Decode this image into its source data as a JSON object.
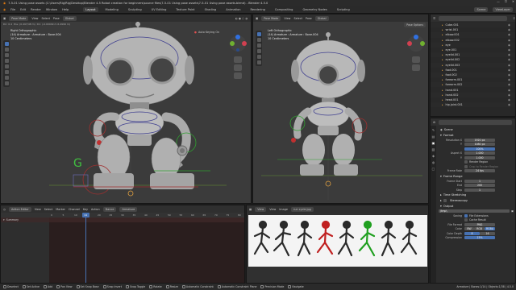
{
  "window": {
    "title": "7-5-01 Using pose assets (C:\\Users\\Rig\\Rig\\Desktop\\Blender 4.5 Robot creation for beginners\\source files\\7-5-01 Using pose assets\\7-5-01 Using pose assets.blend) - Blender 4.5.0",
    "min": "—",
    "max": "☐",
    "close": "✕"
  },
  "menus": [
    "File",
    "Edit",
    "Render",
    "Window",
    "Help"
  ],
  "workspaces": [
    "Layout",
    "Modeling",
    "Sculpting",
    "UV Editing",
    "Texture Paint",
    "Shading",
    "Animation",
    "Rendering",
    "Compositing",
    "Geometry Nodes",
    "Scripting"
  ],
  "active_workspace": "Layout",
  "scene_name": "Scene",
  "view_layer": "ViewLayer",
  "viewport_left": {
    "mode": "Pose Mode",
    "menu": [
      "View",
      "Select",
      "Pose"
    ],
    "orientation": "Global",
    "auto_keying": "Auto Keying On",
    "info": [
      "Right Orthographic",
      "(14) Armature : Armature : Bone.004",
      "10 Centimeters"
    ],
    "stats": [
      "Dir: 0.4",
      "Pos: (0.497/48 m)",
      "Dir: (-0.00049 m 6.4999 m)"
    ]
  },
  "viewport_right": {
    "mode": "Pose Mode",
    "menu": [
      "View",
      "Select",
      "Pose"
    ],
    "orientation": "Global",
    "pose_options": "Pose Options",
    "info": [
      "Left Orthographic",
      "(14) Armature : Armature : Bone.004",
      "10 Centimeters"
    ]
  },
  "outliner": {
    "items": [
      {
        "name": "Cube.001",
        "kind": "mesh"
      },
      {
        "name": "wrist.001",
        "kind": "mesh"
      },
      {
        "name": "elbow.001",
        "kind": "mesh"
      },
      {
        "name": "elbow.002",
        "kind": "mesh"
      },
      {
        "name": "eye",
        "kind": "mesh"
      },
      {
        "name": "eye.001",
        "kind": "mesh"
      },
      {
        "name": "eyelid.001",
        "kind": "mesh"
      },
      {
        "name": "eyelid.002",
        "kind": "mesh"
      },
      {
        "name": "eyelid.003",
        "kind": "mesh"
      },
      {
        "name": "foot.001",
        "kind": "mesh"
      },
      {
        "name": "foot.002",
        "kind": "mesh"
      },
      {
        "name": "forearm.001",
        "kind": "mesh"
      },
      {
        "name": "forearm.002",
        "kind": "mesh"
      },
      {
        "name": "hand.001",
        "kind": "mesh"
      },
      {
        "name": "hand.002",
        "kind": "mesh"
      },
      {
        "name": "head.001",
        "kind": "mesh"
      },
      {
        "name": "hip.joint.001",
        "kind": "mesh"
      }
    ]
  },
  "properties": {
    "scene": "Scene",
    "format_title": "Format",
    "resolution_x_label": "Resolution X",
    "resolution_x": "1920 px",
    "resolution_y_label": "Y",
    "resolution_y": "1080 px",
    "resolution_pct": "100%",
    "aspect_x_label": "Aspect X",
    "aspect_x": "1.000",
    "aspect_y_label": "Y",
    "aspect_y": "1.000",
    "render_region": "Render Region",
    "crop": "Crop to Render Region",
    "frame_rate_label": "Frame Rate",
    "frame_rate": "24 fps",
    "frame_range_title": "Frame Range",
    "frame_start_label": "Frame Start",
    "frame_start": "1",
    "frame_end_label": "End",
    "frame_end": "200",
    "frame_step_label": "Step",
    "frame_step": "1",
    "time_stretching": "Time Stretching",
    "stereoscopy": "Stereoscopy",
    "output_title": "Output",
    "output_path": "/tmp\\",
    "saving_label": "Saving",
    "file_ext": "File Extensions",
    "cache_result": "Cache Result",
    "file_format_label": "File Format",
    "file_format": "PNG",
    "color_label": "Color",
    "color_opts": [
      "BW",
      "RGB",
      "RGBA"
    ],
    "color_depth_label": "Color Depth",
    "color_depth_opts": [
      "8",
      "16"
    ],
    "compression_label": "Compression",
    "compression": "15%"
  },
  "action_editor": {
    "mode": "Action Editor",
    "menu": [
      "View",
      "Select",
      "Marker",
      "Channel",
      "Key"
    ],
    "action_label": "Action",
    "action_name": "Dance",
    "object": "Armature",
    "frames": [
      "0",
      "5",
      "10",
      "15",
      "20",
      "25",
      "30",
      "35",
      "40",
      "45",
      "50",
      "55",
      "60",
      "65",
      "70",
      "75",
      "80"
    ],
    "current_frame": "14",
    "summary": "Summary"
  },
  "image_editor": {
    "mode": "View",
    "menu": [
      "View",
      "Image"
    ],
    "image_name": "run cycle.jpg"
  },
  "statusbar": {
    "items": [
      "Deselect",
      "Set Active",
      "Add",
      "Pan View",
      "Set Snap Base",
      "Snap Invert",
      "Snap Toggle",
      "Rotate",
      "Resize",
      "Automatic Constraint",
      "Automatic Constraint Plane",
      "Precision Mode",
      "Navigate"
    ],
    "right": "Armature | Bones:1/14 | Objects:1/38 | 4.5.0"
  },
  "colors": {
    "accent": "#4772b3",
    "timeline_bg": "#2a1e1e",
    "playhead": "#4772b3",
    "x_axis": "#d04050",
    "y_axis": "#70b030",
    "gizmo_z": "#3070e0"
  }
}
